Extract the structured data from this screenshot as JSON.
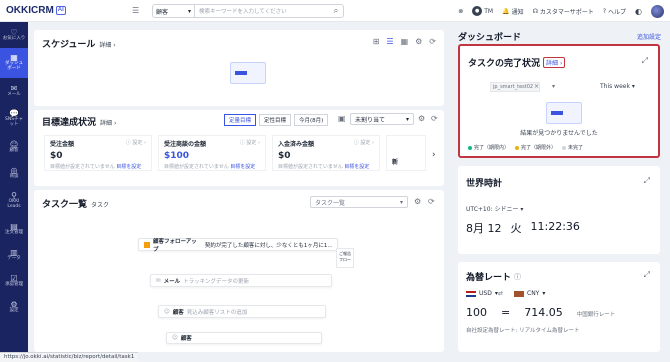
{
  "header": {
    "logo_text": "OKKICRM",
    "logo_badge": "AI",
    "search_category": "顧客",
    "search_placeholder": "検索キーワードを入力してください",
    "user_initials": "TM",
    "notifications": "通知",
    "support": "カスタマーサポート",
    "help": "ヘルプ"
  },
  "sidebar": {
    "items": [
      {
        "label": "お気に入り",
        "icon": "heart-icon"
      },
      {
        "label": "ダッシュボード",
        "icon": "dashboard-icon",
        "active": true
      },
      {
        "label": "メール",
        "icon": "mail-icon"
      },
      {
        "label": "SNSチャット",
        "icon": "chat-icon"
      },
      {
        "label": "顧客",
        "icon": "customer-icon"
      },
      {
        "label": "商談",
        "icon": "deal-icon"
      },
      {
        "label": "OKKI Leads",
        "icon": "leads-icon"
      },
      {
        "label": "注文管理",
        "icon": "order-icon"
      },
      {
        "label": "データ",
        "icon": "data-icon"
      },
      {
        "label": "承認管理",
        "icon": "approval-icon"
      },
      {
        "label": "設定",
        "icon": "settings-icon"
      }
    ]
  },
  "schedule": {
    "title": "スケジュール",
    "detail": "詳細"
  },
  "goals": {
    "title": "目標達成状況",
    "detail": "詳細",
    "tab_fixed": "定量目標",
    "tab_qual": "定性目標",
    "period": "今月(8月)",
    "unassigned": "未割り当て",
    "cards": [
      {
        "title": "受注金額",
        "setting": "設定",
        "value": "$0",
        "desc": "目標値が設定されていません",
        "action": "目標を設定"
      },
      {
        "title": "受注商談の金額",
        "setting": "設定",
        "value": "$100",
        "desc": "目標値が設定されていません",
        "action": "目標を設定"
      },
      {
        "title": "入金済み金額",
        "setting": "設定",
        "value": "$0",
        "desc": "目標値が設定されていません",
        "action": "目標を設定"
      }
    ],
    "new_label": "新"
  },
  "tasks": {
    "title": "タスク一覧",
    "subtitle": "タスク",
    "select_placeholder": "タスク一覧",
    "preview": {
      "row1_title": "顧客フォローアップ",
      "row1_desc": "契約が完了した顧客に対し、少なくとも1ヶ月に1…",
      "row1_menu1": "ご報告",
      "row1_menu2": "フロー",
      "row2_label": "メール",
      "row2_desc": "トラッキングデータの更新",
      "row3_label": "顧客",
      "row3_desc": "見込み顧客リストの追加",
      "row4_label": "顧客"
    }
  },
  "dashboard": {
    "title": "ダッシュボード",
    "add_settings": "追加設定"
  },
  "task_status": {
    "title": "タスクの完了状況",
    "detail": "詳細",
    "user_filter": "jp_smart_test02",
    "period": "This week",
    "empty": "結果が見つかりませんでした",
    "legend": [
      {
        "label": "完了（期限内）",
        "color": "#10b981"
      },
      {
        "label": "完了（期限外）",
        "color": "#eab308"
      },
      {
        "label": "未完了",
        "color": "#d1d5db"
      }
    ]
  },
  "world_clock": {
    "title": "世界時計",
    "timezone": "UTC+10: シドニー",
    "date": "8月 12",
    "weekday": "火",
    "time": "11:22:36"
  },
  "fx": {
    "title": "為替レート",
    "from": "USD",
    "to": "CNY",
    "amount": "100",
    "equals": "=",
    "result": "714.05",
    "source": "中国銀行レート",
    "note": "自社設定為替レート: リアルタイム為替レート"
  },
  "status_url": "https://jo.okki.ai/statistic/biz/report/detail/task1",
  "colors": {
    "accent": "#3a53e0",
    "sidebar": "#1a2461",
    "highlight": "#c0353f"
  }
}
